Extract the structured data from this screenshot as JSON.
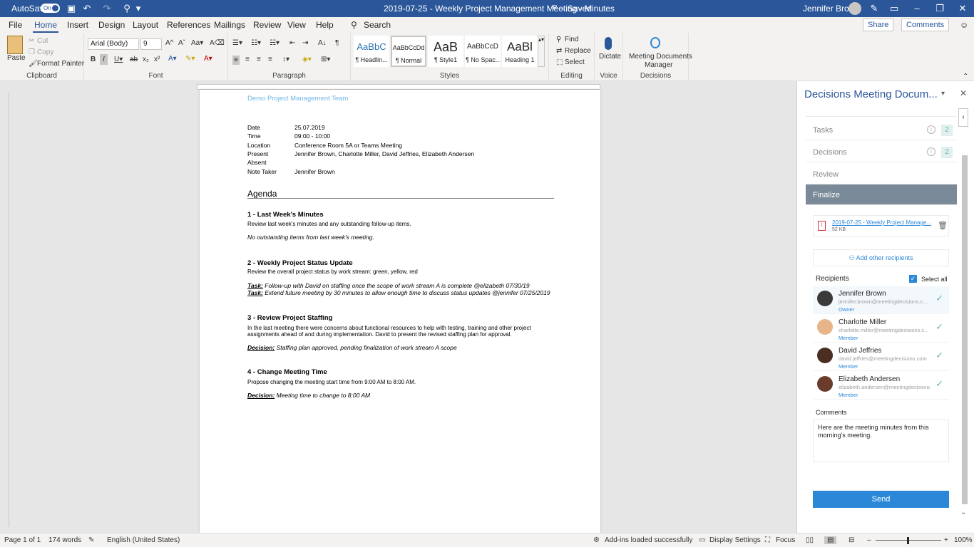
{
  "titlebar": {
    "autosave": "AutoSave",
    "toggle": "On",
    "title": "2019-07-25 - Weekly Project Management Meeting - Minutes",
    "saved": "Saved",
    "user": "Jennifer Brown"
  },
  "menu": {
    "tabs": [
      "File",
      "Home",
      "Insert",
      "Design",
      "Layout",
      "References",
      "Mailings",
      "Review",
      "View",
      "Help"
    ],
    "search": "Search",
    "share": "Share",
    "comments": "Comments"
  },
  "ribbon": {
    "clipboard": {
      "paste": "Paste",
      "cut": "Cut",
      "copy": "Copy",
      "format_painter": "Format Painter",
      "label": "Clipboard"
    },
    "font": {
      "name": "Arial (Body)",
      "size": "9",
      "label": "Font"
    },
    "paragraph": {
      "label": "Paragraph"
    },
    "styles": {
      "label": "Styles",
      "items": [
        {
          "preview": "AaBbC",
          "name": "¶ Headlin..."
        },
        {
          "preview": "AaBbCcDd",
          "name": "¶ Normal"
        },
        {
          "preview": "AaB",
          "name": "¶ Style1"
        },
        {
          "preview": "AaBbCcD",
          "name": "¶ No Spac..."
        },
        {
          "preview": "AaBl",
          "name": "Heading 1"
        }
      ]
    },
    "editing": {
      "find": "Find",
      "replace": "Replace",
      "select": "Select",
      "label": "Editing"
    },
    "voice": {
      "dictate": "Dictate",
      "label": "Voice"
    },
    "decisions": {
      "btn1": "Meeting Documents",
      "btn2": "Manager",
      "label": "Decisions"
    }
  },
  "doc": {
    "team": "Demo Project Management Team",
    "meta": [
      {
        "k": "Date",
        "v": "25.07.2019"
      },
      {
        "k": "Time",
        "v": "09:00 - 10:00"
      },
      {
        "k": "Location",
        "v": "Conference Room 5A or Teams Meeting"
      },
      {
        "k": "Present",
        "v": "Jennifer Brown, Charlotte Miller, David Jeffries, Elizabeth Andersen"
      },
      {
        "k": "Absent",
        "v": ""
      },
      {
        "k": "Note Taker",
        "v": "Jennifer Brown"
      }
    ],
    "agenda": "Agenda",
    "s1": {
      "h": "1 - Last Week's Minutes",
      "d": "Review last week's minutes and any outstanding follow-up items.",
      "n": "No outstanding items from last week's meeting."
    },
    "s2": {
      "h": "2 - Weekly Project Status Update",
      "d": "Review the overall project status by work stream: green, yellow, red",
      "t1k": "Task:",
      "t1": " Follow-up with David on staffing once the scope of work stream A is complete @elizabeth 07/30/19",
      "t2k": "Task:",
      "t2": " Extend future meeting by 30 minutes to allow enough time to discuss status updates @jennifer 07/25/2019"
    },
    "s3": {
      "h": "3 - Review Project Staffing",
      "d1": "In the last meeting there were concerns about functional resources to help with testing, training and other project",
      "d2": "assignments ahead of and during implementation. David to present the revised staffing plan for approval.",
      "dk": "Decision:",
      "dv": " Staffing plan approved, pending finalization of work stream A scope"
    },
    "s4": {
      "h": "4 - Change Meeting Time",
      "d": "Propose changing the meeting start time from 9:00 AM to 8:00 AM.",
      "dk": "Decision:",
      "dv": " Meeting time to change to 8:00 AM"
    }
  },
  "pane": {
    "title": "Decisions Meeting Docum...",
    "steps": [
      {
        "label": "Tasks",
        "count": "2"
      },
      {
        "label": "Decisions",
        "count": "2"
      },
      {
        "label": "Review"
      },
      {
        "label": "Finalize"
      }
    ],
    "file": {
      "name": "2019-07-25 - Weekly Project Manage...",
      "size": "52 KB"
    },
    "add_recipients": "Add other recipients",
    "recipients_label": "Recipients",
    "select_all": "Select all",
    "recipients": [
      {
        "name": "Jennifer Brown",
        "email": "jennifer.brown@meetingdecisions.c...",
        "role": "Owner"
      },
      {
        "name": "Charlotte Miller",
        "email": "charlotte.miller@meetingdecisions.c...",
        "role": "Member"
      },
      {
        "name": "David Jeffries",
        "email": "david.jeffries@meetingdecisions.com",
        "role": "Member"
      },
      {
        "name": "Elizabeth Andersen",
        "email": "elizabeth.andersen@meetingdecisions.c...",
        "role": "Member"
      }
    ],
    "comments_label": "Comments",
    "comment_text": "Here are the meeting minutes from this morning's meeting.",
    "send": "Send"
  },
  "status": {
    "page": "Page 1 of 1",
    "words": "174 words",
    "lang": "English (United States)",
    "addins": "Add-ins loaded successfully",
    "display": "Display Settings",
    "focus": "Focus",
    "zoom": "100%"
  }
}
